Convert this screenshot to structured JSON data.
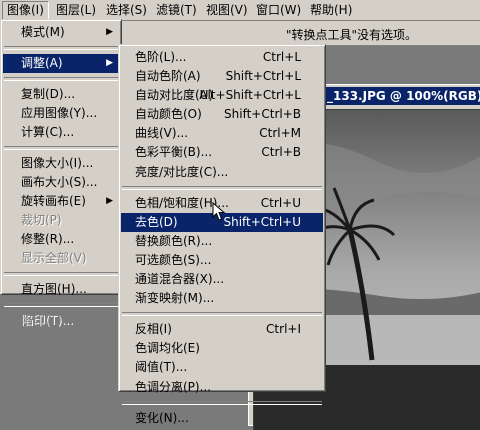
{
  "menubar": {
    "items": [
      "图像(I)",
      "图层(L)",
      "选择(S)",
      "滤镜(T)",
      "视图(V)",
      "窗口(W)",
      "帮助(H)"
    ]
  },
  "options_bar": {
    "message": "\"转换点工具\"没有选项。"
  },
  "document": {
    "title": "_133.JPG @ 100%(RGB)"
  },
  "image_menu": {
    "items": [
      {
        "label": "模式(M)",
        "submenu": true
      },
      {
        "label": "调整(A)",
        "submenu": true,
        "highlighted": true
      },
      {
        "label": "复制(D)..."
      },
      {
        "label": "应用图像(Y)..."
      },
      {
        "label": "计算(C)..."
      },
      {
        "label": "图像大小(I)..."
      },
      {
        "label": "画布大小(S)..."
      },
      {
        "label": "旋转画布(E)",
        "submenu": true
      },
      {
        "label": "裁切(P)",
        "disabled": true
      },
      {
        "label": "修整(R)..."
      },
      {
        "label": "显示全部(V)",
        "disabled": true
      },
      {
        "label": "直方图(H)..."
      },
      {
        "label": "陷印(T)...",
        "disabled": true
      }
    ]
  },
  "adjust_menu": {
    "items": [
      {
        "label": "色阶(L)...",
        "shortcut": "Ctrl+L"
      },
      {
        "label": "自动色阶(A)",
        "shortcut": "Shift+Ctrl+L"
      },
      {
        "label": "自动对比度(U)",
        "shortcut": "Alt+Shift+Ctrl+L"
      },
      {
        "label": "自动颜色(O)",
        "shortcut": "Shift+Ctrl+B"
      },
      {
        "label": "曲线(V)...",
        "shortcut": "Ctrl+M"
      },
      {
        "label": "色彩平衡(B)...",
        "shortcut": "Ctrl+B"
      },
      {
        "label": "亮度/对比度(C)...",
        "shortcut": ""
      },
      {
        "label": "色相/饱和度(H)...",
        "shortcut": "Ctrl+U"
      },
      {
        "label": "去色(D)",
        "shortcut": "Shift+Ctrl+U",
        "highlighted": true
      },
      {
        "label": "替换颜色(R)...",
        "shortcut": ""
      },
      {
        "label": "可选颜色(S)...",
        "shortcut": ""
      },
      {
        "label": "通道混合器(X)...",
        "shortcut": ""
      },
      {
        "label": "渐变映射(M)...",
        "shortcut": ""
      },
      {
        "label": "反相(I)",
        "shortcut": "Ctrl+I"
      },
      {
        "label": "色调均化(E)",
        "shortcut": ""
      },
      {
        "label": "阈值(T)...",
        "shortcut": ""
      },
      {
        "label": "色调分离(P)...",
        "shortcut": ""
      },
      {
        "label": "变化(N)...",
        "shortcut": ""
      }
    ]
  }
}
